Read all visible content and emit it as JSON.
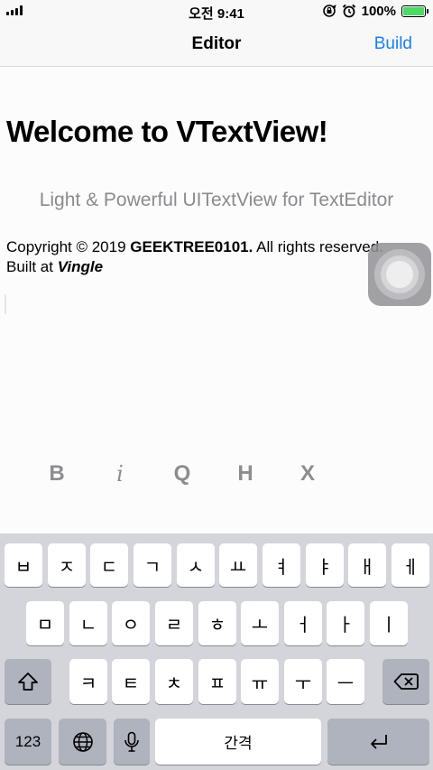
{
  "status_bar": {
    "time": "오전 9:41",
    "battery": "100%",
    "battery_level": 1.0,
    "icons": [
      "signal-icon",
      "rotation-lock-icon",
      "alarm-icon",
      "battery-icon"
    ]
  },
  "nav": {
    "title": "Editor",
    "build_label": "Build",
    "accent_color": "#1b7ff0"
  },
  "editor": {
    "heading": "Welcome to VTextView!",
    "subtitle": "Light & Powerful UITextView for TextEditor",
    "copyright_prefix": "Copyright © 2019 ",
    "copyright_bold": "GEEKTREE0101.",
    "copyright_suffix": " All rights reserved.",
    "built_prefix": "Built at ",
    "built_name": "Vingle"
  },
  "format_bar": {
    "bold": "B",
    "italic": "i",
    "quote": "Q",
    "heading": "H",
    "clear": "X"
  },
  "keyboard": {
    "row1": [
      "ㅂ",
      "ㅈ",
      "ㄷ",
      "ㄱ",
      "ㅅ",
      "ㅛ",
      "ㅕ",
      "ㅑ",
      "ㅐ",
      "ㅔ"
    ],
    "row2": [
      "ㅁ",
      "ㄴ",
      "ㅇ",
      "ㄹ",
      "ㅎ",
      "ㅗ",
      "ㅓ",
      "ㅏ",
      "ㅣ"
    ],
    "row3": [
      "ㅋ",
      "ㅌ",
      "ㅊ",
      "ㅍ",
      "ㅠ",
      "ㅜ",
      "ㅡ"
    ],
    "numbers_label": "123",
    "space_label": "간격"
  }
}
